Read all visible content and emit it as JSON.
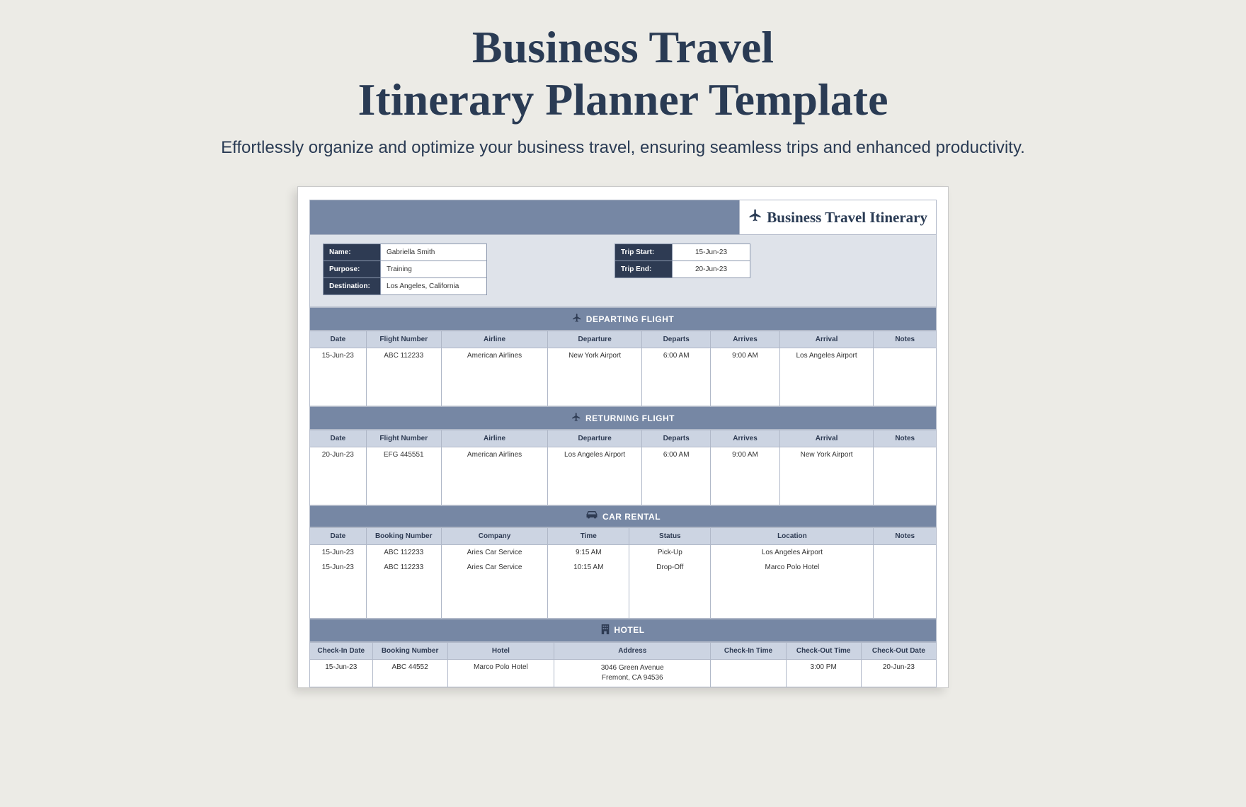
{
  "hero": {
    "title_line1": "Business Travel",
    "title_line2": "Itinerary Planner Template",
    "subtitle": "Effortlessly organize and optimize your business travel, ensuring seamless trips and enhanced productivity."
  },
  "document": {
    "header_title": "Business Travel Itinerary",
    "info_left": [
      {
        "label": "Name:",
        "value": "Gabriella Smith"
      },
      {
        "label": "Purpose:",
        "value": "Training"
      },
      {
        "label": "Destination:",
        "value": "Los Angeles, California"
      }
    ],
    "info_right": [
      {
        "label": "Trip Start:",
        "value": "15-Jun-23"
      },
      {
        "label": "Trip End:",
        "value": "20-Jun-23"
      }
    ],
    "sections": {
      "departing": {
        "title": "DEPARTING FLIGHT",
        "headers": [
          "Date",
          "Flight Number",
          "Airline",
          "Departure",
          "Departs",
          "Arrives",
          "Arrival",
          "Notes"
        ],
        "rows": [
          [
            "15-Jun-23",
            "ABC 112233",
            "American Airlines",
            "New York Airport",
            "6:00 AM",
            "9:00 AM",
            "Los Angeles Airport",
            ""
          ]
        ]
      },
      "returning": {
        "title": "RETURNING FLIGHT",
        "headers": [
          "Date",
          "Flight Number",
          "Airline",
          "Departure",
          "Departs",
          "Arrives",
          "Arrival",
          "Notes"
        ],
        "rows": [
          [
            "20-Jun-23",
            "EFG 445551",
            "American Airlines",
            "Los Angeles Airport",
            "6:00 AM",
            "9:00 AM",
            "New York Airport",
            ""
          ]
        ]
      },
      "car": {
        "title": "CAR RENTAL",
        "headers": [
          "Date",
          "Booking Number",
          "Company",
          "Time",
          "Status",
          "Location",
          "Notes"
        ],
        "rows": [
          [
            "15-Jun-23",
            "ABC 112233",
            "Aries Car Service",
            "9:15 AM",
            "Pick-Up",
            "Los Angeles Airport",
            ""
          ],
          [
            "15-Jun-23",
            "ABC 112233",
            "Aries Car Service",
            "10:15 AM",
            "Drop-Off",
            "Marco Polo Hotel",
            ""
          ]
        ]
      },
      "hotel": {
        "title": "HOTEL",
        "headers": [
          "Check-In Date",
          "Booking Number",
          "Hotel",
          "Address",
          "Check-In Time",
          "Check-Out Time",
          "Check-Out Date"
        ],
        "rows": [
          [
            "15-Jun-23",
            "ABC 44552",
            "Marco Polo Hotel",
            "3046 Green Avenue\nFremont, CA 94536",
            "",
            "3:00 PM",
            "20-Jun-23"
          ]
        ]
      }
    }
  }
}
